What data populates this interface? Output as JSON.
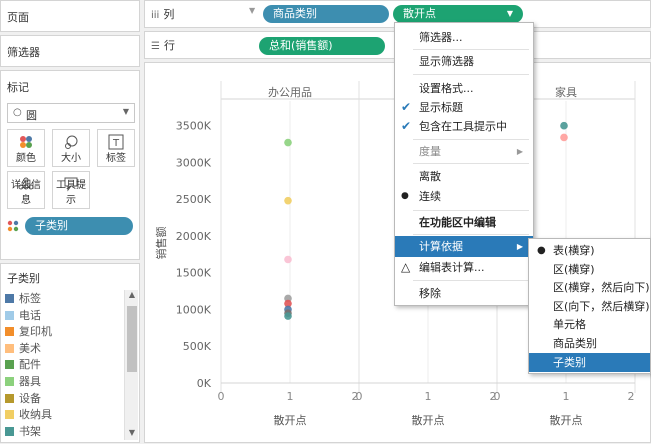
{
  "left": {
    "pages_title": "页面",
    "filters_title": "筛选器",
    "marks_title": "标记",
    "mark_type": "圆",
    "mark_buttons": [
      "颜色",
      "大小",
      "标签",
      "详细信息",
      "工具提示"
    ],
    "color_pill": "子类别"
  },
  "legend": {
    "title": "子类别",
    "items": [
      {
        "label": "标签",
        "color": "#4e79a7"
      },
      {
        "label": "电话",
        "color": "#a0cbe8"
      },
      {
        "label": "复印机",
        "color": "#f28e2b"
      },
      {
        "label": "美术",
        "color": "#ffbe7d"
      },
      {
        "label": "配件",
        "color": "#59a14f"
      },
      {
        "label": "器具",
        "color": "#8cd17d"
      },
      {
        "label": "设备",
        "color": "#b6992d"
      },
      {
        "label": "收纳具",
        "color": "#f1ce63"
      },
      {
        "label": "书架",
        "color": "#499894"
      }
    ]
  },
  "shelves": {
    "columns_label": "列",
    "rows_label": "行",
    "columns_pills": [
      "商品类别",
      "散开点"
    ],
    "rows_pill": "总和(销售额)"
  },
  "chart_data": {
    "type": "scatter",
    "panes": [
      "办公用品",
      "",
      "家具"
    ],
    "xlabel": "散开点",
    "ylabel": "销售额",
    "xticks": [
      "0",
      "1",
      "2"
    ],
    "yticks": [
      "3500K",
      "3000K",
      "2500K",
      "2000K",
      "1500K",
      "1000K",
      "500K",
      "0K"
    ],
    "ylim": [
      0,
      3700
    ],
    "points": [
      {
        "pane": 0,
        "x": 1,
        "y": 3270,
        "color": "#8cd17d"
      },
      {
        "pane": 0,
        "x": 1,
        "y": 2480,
        "color": "#f1ce63"
      },
      {
        "pane": 0,
        "x": 1,
        "y": 1680,
        "color": "#fabfd2"
      },
      {
        "pane": 0,
        "x": 1,
        "y": 1150,
        "color": "#a0a0a0"
      },
      {
        "pane": 0,
        "x": 1,
        "y": 1080,
        "color": "#e15759"
      },
      {
        "pane": 0,
        "x": 1,
        "y": 1000,
        "color": "#4e79a7"
      },
      {
        "pane": 0,
        "x": 1,
        "y": 950,
        "color": "#79706e"
      },
      {
        "pane": 0,
        "x": 1,
        "y": 910,
        "color": "#499894"
      },
      {
        "pane": 2,
        "x": 1,
        "y": 3500,
        "color": "#499894"
      },
      {
        "pane": 2,
        "x": 1,
        "y": 3340,
        "color": "#ff9d9a"
      }
    ]
  },
  "menu": {
    "items": [
      "筛选器...",
      "显示筛选器",
      "设置格式...",
      "显示标题",
      "包含在工具提示中",
      "度量",
      "离散",
      "连续",
      "在功能区中编辑",
      "计算依据",
      "编辑表计算...",
      "移除"
    ]
  },
  "submenu": {
    "items": [
      "表(横穿)",
      "区(横穿)",
      "区(横穿，然后向下)",
      "区(向下，然后横穿)",
      "单元格",
      "商品类别",
      "子类别"
    ]
  }
}
